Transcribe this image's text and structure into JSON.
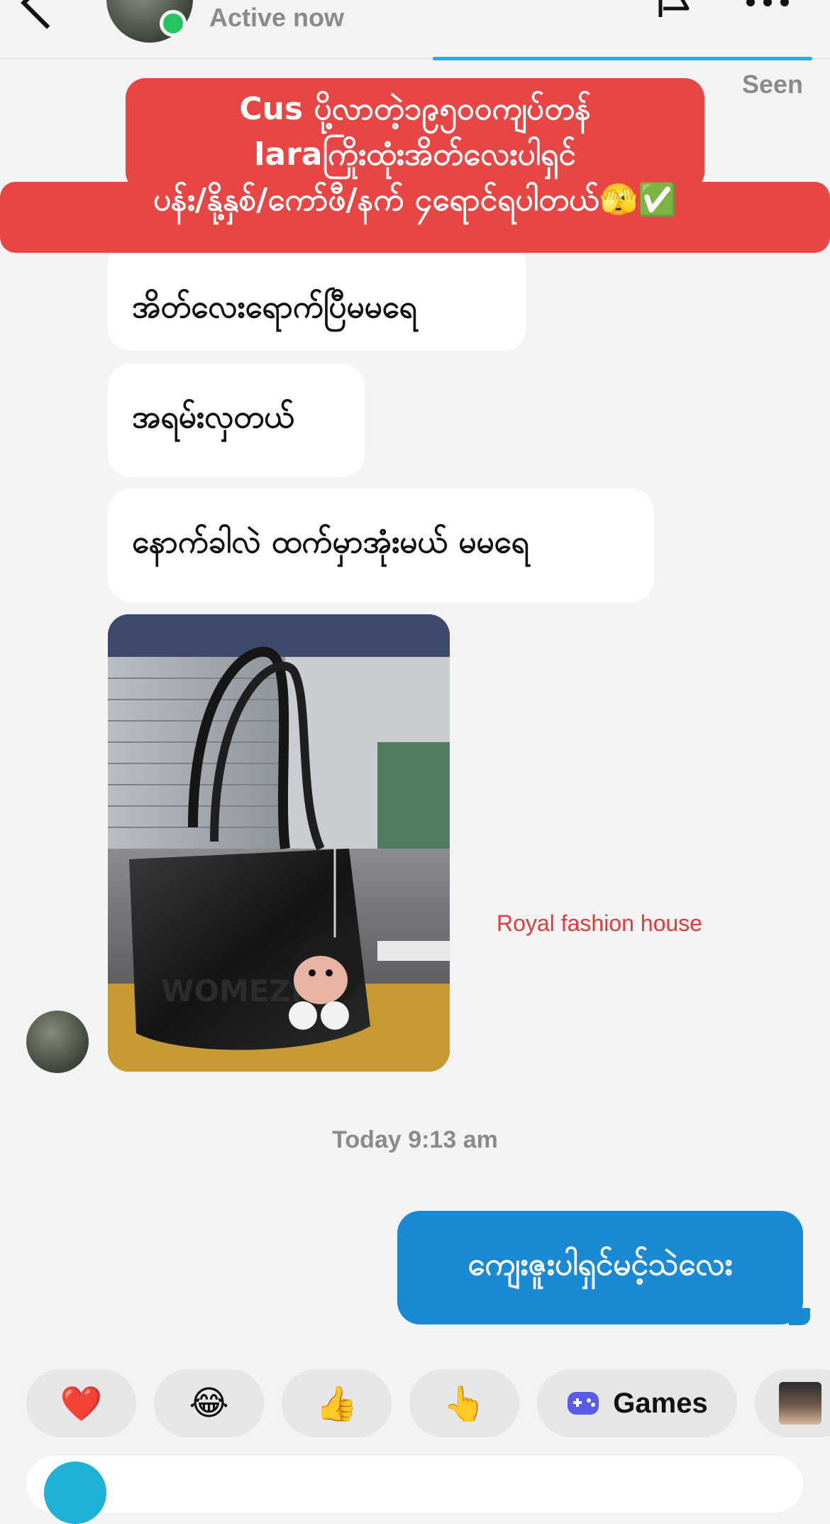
{
  "header": {
    "status": "Active now"
  },
  "thread": {
    "seen_label": "Seen",
    "caption": {
      "lines": [
        "Cus ပို့လာတဲ့၁၉၅၀၀ကျပ်တန်",
        "laraကြိုးထုံးအိတ်လေးပါရှင်",
        "ပန်း/နို့နှစ်/ကော်ဖီ/နက် ၄ရောင်ရပါတယ်🫣✅"
      ],
      "color": "#e84545"
    },
    "received": [
      {
        "text": "အိတ်လေးရောက်ပြီမမရေ"
      },
      {
        "text": "အရမ်းလှတယ်"
      },
      {
        "text": "နောက်ခါလဲ ထက်မှာအုံးမယ် မမရေ"
      }
    ],
    "photo_watermark": "Royal fashion house",
    "timestamp": "Today 9:13 am",
    "sent": [
      {
        "text": "ကျေးဇူးပါရှင်မင့်သဲလေး",
        "color": "#1a8ad4"
      }
    ]
  },
  "quick_replies": [
    {
      "icon": "heart-icon",
      "glyph": "❤️"
    },
    {
      "icon": "laughing-emoji-icon",
      "glyph": "😂"
    },
    {
      "icon": "thumbs-up-icon",
      "glyph": "👍"
    },
    {
      "icon": "pointing-hand-icon",
      "glyph": "👆"
    },
    {
      "icon": "gamepad-icon",
      "label": "Games"
    },
    {
      "icon": "sticker-thumbnail-icon"
    }
  ],
  "colors": {
    "accent_blue": "#1a8ad4",
    "online_green": "#23c55e",
    "teal": "#1fb2d6"
  }
}
